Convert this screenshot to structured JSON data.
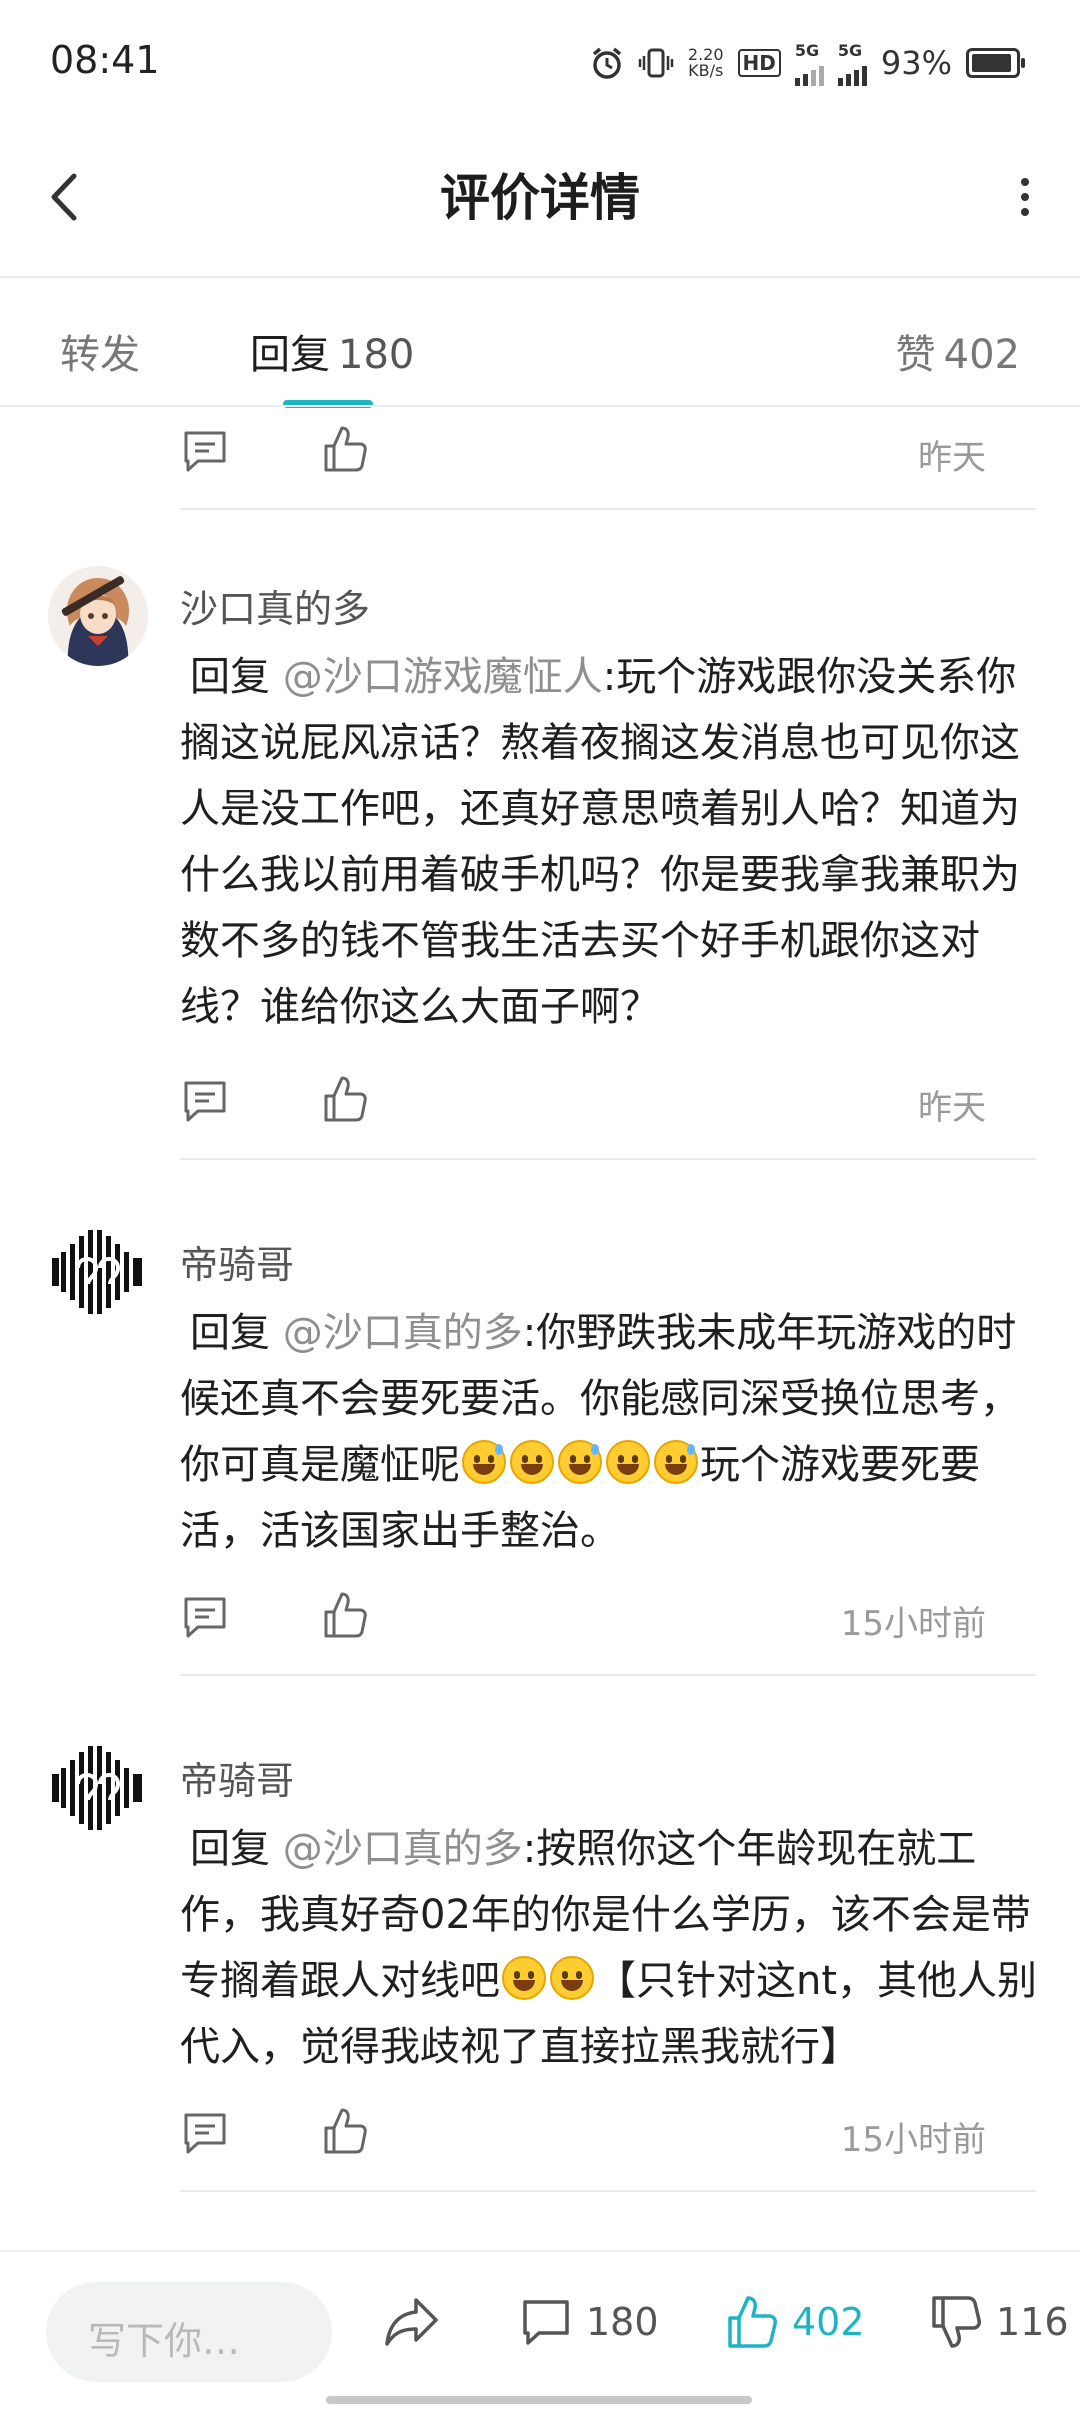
{
  "status_bar": {
    "time": "08:41",
    "net_speed_value": "2.20",
    "net_speed_unit": "KB/s",
    "hd_label": "HD",
    "signal1_label": "5G",
    "signal2_label": "5G",
    "battery_percent": "93%",
    "battery_level": 0.93
  },
  "header": {
    "title": "评价详情"
  },
  "tabs": {
    "forward": {
      "label": "转发"
    },
    "reply": {
      "label": "回复",
      "count": "180"
    },
    "like": {
      "label": "赞",
      "count": "402"
    }
  },
  "top_item": {
    "time": "昨天"
  },
  "comments": [
    {
      "user": "沙口真的多",
      "reply_prefix": "回复 ",
      "mention": "@沙口游戏魔怔人",
      "text": ":玩个游戏跟你没关系你搁这说屁风凉话？熬着夜搁这发消息也可见你这人是没工作吧，还真好意思喷着别人哈？知道为什么我以前用着破手机吗？你是要我拿我兼职为数不多的钱不管我生活去买个好手机跟你这对线？谁给你这么大面子啊？",
      "time": "昨天"
    },
    {
      "user": "帝骑哥",
      "reply_prefix": "回复 ",
      "mention": "@沙口真的多",
      "text": ":你野跌我未成年玩游戏的时候还真不会要死要活。你能感同深受换位思考，你可真是魔怔呢",
      "text_after": "玩个游戏要死要活，活该国家出手整治。",
      "time": "15小时前"
    },
    {
      "user": "帝骑哥",
      "reply_prefix": "回复 ",
      "mention": "@沙口真的多",
      "text": ":按照你这个年龄现在就工作，我真好奇02年的你是什么学历，该不会是带专搁着跟人对线吧",
      "text_after": "【只针对这nt，其他人别代入，觉得我歧视了直接拉黑我就行】",
      "time": "15小时前"
    }
  ],
  "bottom_bar": {
    "input_placeholder": "写下你…",
    "reply_count": "180",
    "like_count": "402",
    "dislike_count": "116"
  },
  "colors": {
    "accent": "#1fb4c2",
    "mention": "#8f8f8f",
    "muted": "#9a9a9a"
  }
}
